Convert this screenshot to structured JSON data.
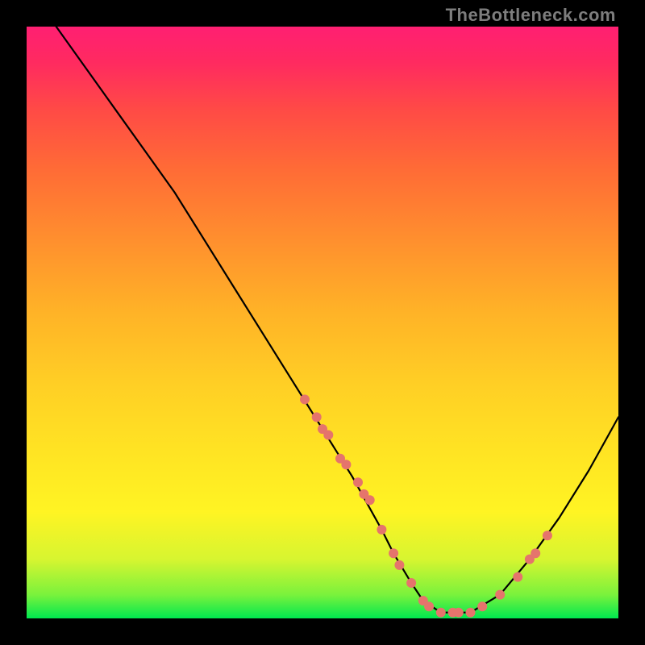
{
  "watermark": "TheBottleneck.com",
  "colors": {
    "dot": "#e5746c",
    "curve": "#000000"
  },
  "chart_data": {
    "type": "line",
    "title": "",
    "xlabel": "",
    "ylabel": "",
    "xlim": [
      0,
      100
    ],
    "ylim": [
      0,
      100
    ],
    "grid": false,
    "note": "Axes are unlabeled in the source image; values are relative (0–100) estimated from pixel positions. y is plotted with 0 at the bottom.",
    "series": [
      {
        "name": "curve",
        "kind": "line",
        "x": [
          5,
          10,
          15,
          20,
          25,
          30,
          35,
          40,
          45,
          50,
          55,
          60,
          62,
          65,
          67,
          70,
          75,
          80,
          85,
          90,
          95,
          100
        ],
        "y": [
          100,
          93,
          86,
          79,
          72,
          64,
          56,
          48,
          40,
          32,
          24,
          15,
          11,
          6,
          3,
          1,
          1,
          4,
          10,
          17,
          25,
          34
        ]
      },
      {
        "name": "dots",
        "kind": "scatter",
        "x": [
          47,
          49,
          50,
          51,
          53,
          54,
          56,
          57,
          58,
          60,
          62,
          63,
          65,
          67,
          68,
          70,
          72,
          73,
          75,
          77,
          80,
          83,
          85,
          86,
          88
        ],
        "y": [
          37,
          34,
          32,
          31,
          27,
          26,
          23,
          21,
          20,
          15,
          11,
          9,
          6,
          3,
          2,
          1,
          1,
          1,
          1,
          2,
          4,
          7,
          10,
          11,
          14
        ]
      }
    ]
  }
}
